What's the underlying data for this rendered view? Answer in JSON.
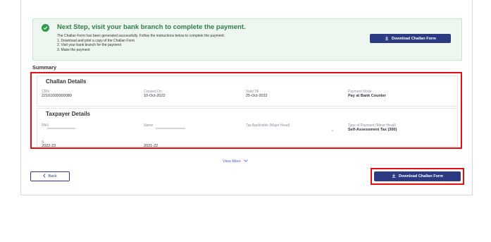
{
  "notice": {
    "title": "Next Step, visit your bank branch to complete the payment.",
    "lines": [
      "The Challan Form has been generated successfully. Follow the instructions below to complete the payment:",
      "1. Download and print a copy of the Challan Form",
      "2. Visit your bank branch for the payment",
      "3. Make the payment"
    ],
    "download_label": "Download Challan Form"
  },
  "summary": {
    "label": "Summary",
    "challan": {
      "title": "Challan Details",
      "fields": [
        {
          "label": "CRN",
          "value": "22101000000080"
        },
        {
          "label": "Created On",
          "value": "10-Oct-2022"
        },
        {
          "label": "Valid Till",
          "value": "25-Oct-2022"
        },
        {
          "label": "Payment Mode",
          "value": "Pay at Bank Counter"
        }
      ]
    },
    "taxpayer": {
      "title": "Taxpayer Details",
      "fields": [
        {
          "label": "PAN",
          "value": ""
        },
        {
          "label": "Name",
          "value": ""
        },
        {
          "label": "Tax Applicable (Major Head)",
          "value": ""
        },
        {
          "label": "Type of Payment (Minor Head)",
          "value": "Self-Assessment Tax (300)"
        }
      ],
      "row2": [
        {
          "label": "A",
          "value": "2022-23"
        },
        {
          "label": "",
          "value": "2021-22"
        }
      ]
    }
  },
  "view_more": "View More",
  "back_label": "Back",
  "download_bottom_label": "Download Challan Form"
}
